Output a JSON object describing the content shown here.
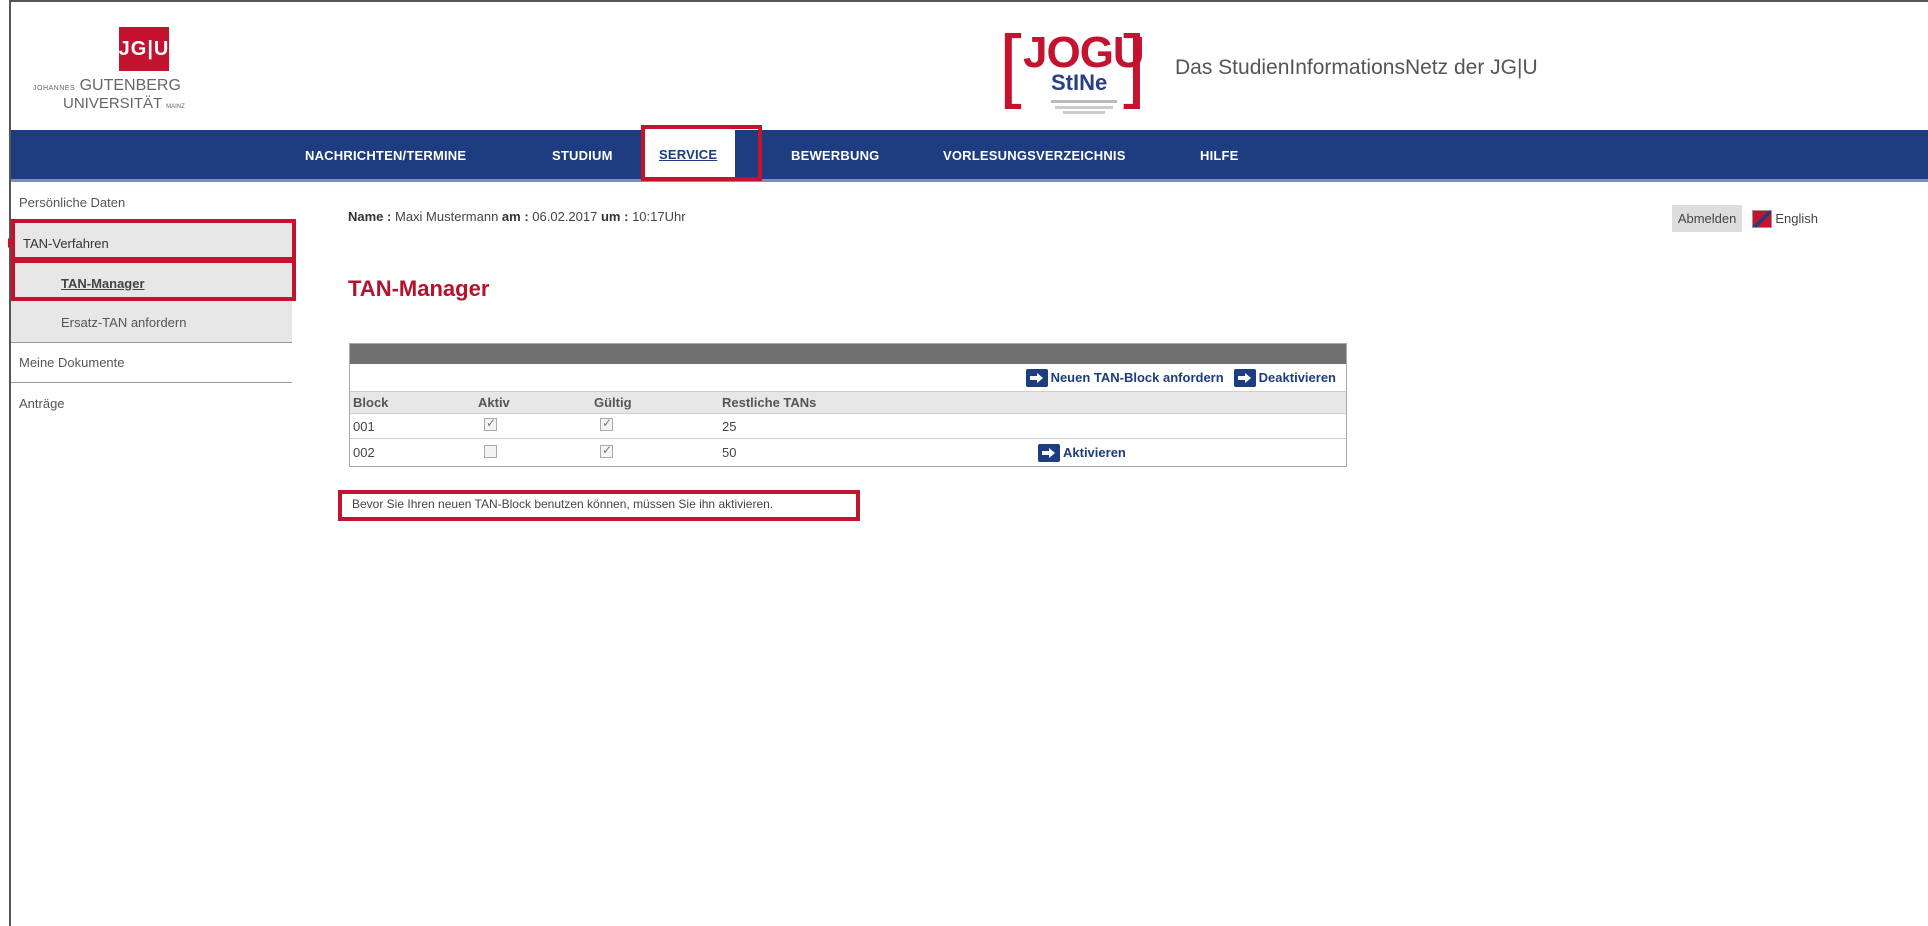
{
  "header": {
    "jgu_mark": "JG|U",
    "jgu_line1_small": "JOHANNES",
    "jgu_line1": "GUTENBERG",
    "jgu_line2": "UNIVERSITÄT",
    "jgu_line2_small": "MAINZ",
    "stine_bracket_left": "[",
    "stine_bracket_right": "]",
    "stine_jogu": "JOGU",
    "stine_word": "StINe",
    "portal_title": "Das StudienInformationsNetz der JG|U"
  },
  "nav": {
    "items": [
      {
        "label": "NACHRICHTEN/TERMINE"
      },
      {
        "label": "STUDIUM"
      },
      {
        "label": "SERVICE"
      },
      {
        "label": "BEWERBUNG"
      },
      {
        "label": "VORLESUNGSVERZEICHNIS"
      },
      {
        "label": "HILFE"
      }
    ]
  },
  "sidebar": {
    "items": [
      {
        "label": "Persönliche Daten"
      },
      {
        "label": "TAN-Verfahren"
      },
      {
        "label": "TAN-Manager"
      },
      {
        "label": "Ersatz-TAN anfordern"
      },
      {
        "label": "Meine Dokumente"
      },
      {
        "label": "Anträge"
      }
    ]
  },
  "userinfo": {
    "name_label": "Name :",
    "name": "Maxi Mustermann",
    "date_label": "am :",
    "date": "06.02.2017",
    "time_label": "um :",
    "time": "10:17Uhr"
  },
  "topright": {
    "logout": "Abmelden",
    "language": "English"
  },
  "page_title": "TAN-Manager",
  "table": {
    "actions": {
      "new_block": "Neuen TAN-Block anfordern",
      "deactivate": "Deaktivieren"
    },
    "columns": [
      "Block",
      "Aktiv",
      "Gültig",
      "Restliche TANs"
    ],
    "rows": [
      {
        "block": "001",
        "aktiv": true,
        "gueltig": true,
        "restliche": "25",
        "action": ""
      },
      {
        "block": "002",
        "aktiv": false,
        "gueltig": true,
        "restliche": "50",
        "action": "Aktivieren"
      }
    ]
  },
  "notice": "Bevor Sie Ihren neuen TAN-Block benutzen können, müssen Sie ihn aktivieren.",
  "colors": {
    "brand_red": "#c4122f",
    "nav_blue": "#1e3c80",
    "highlight": "#c4122f"
  }
}
